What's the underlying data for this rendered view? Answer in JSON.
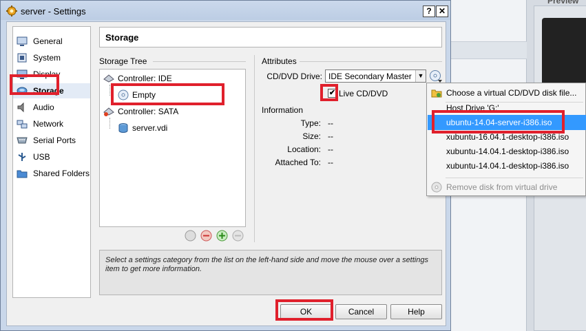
{
  "window": {
    "title": "server - Settings",
    "help_glyph": "?",
    "close_glyph": "✕"
  },
  "categories": [
    {
      "label": "General",
      "icon": "monitor-icon"
    },
    {
      "label": "System",
      "icon": "chip-icon"
    },
    {
      "label": "Display",
      "icon": "display-icon"
    },
    {
      "label": "Storage",
      "icon": "storage-disk-icon",
      "selected": true
    },
    {
      "label": "Audio",
      "icon": "speaker-icon"
    },
    {
      "label": "Network",
      "icon": "network-icon"
    },
    {
      "label": "Serial Ports",
      "icon": "serial-port-icon"
    },
    {
      "label": "USB",
      "icon": "usb-icon"
    },
    {
      "label": "Shared Folders",
      "icon": "folder-icon"
    }
  ],
  "page_title": "Storage",
  "storage_tree": {
    "title": "Storage Tree",
    "ide_controller": "Controller: IDE",
    "ide_disk": "Empty",
    "sata_controller": "Controller: SATA",
    "sata_disk": "server.vdi"
  },
  "attributes": {
    "title": "Attributes",
    "drive_label": "CD/DVD Drive:",
    "drive_value": "IDE Secondary Master",
    "live_cd_label": "Live CD/DVD",
    "live_cd_checked": true
  },
  "information": {
    "title": "Information",
    "type_label": "Type:",
    "type_value": "--",
    "size_label": "Size:",
    "size_value": "--",
    "location_label": "Location:",
    "location_value": "--",
    "attached_label": "Attached To:",
    "attached_value": "--"
  },
  "description": "Select a settings category from the list on the left-hand side and move the mouse over a settings item to get more information.",
  "buttons": {
    "ok": "OK",
    "cancel": "Cancel",
    "help": "Help"
  },
  "disk_menu": {
    "items": [
      {
        "label": "Choose a virtual CD/DVD disk file...",
        "icon": "folder-choose-icon"
      },
      {
        "label": "Host Drive 'G:'"
      },
      {
        "label": "ubuntu-14.04-server-i386.iso",
        "active": true
      },
      {
        "label": "xubuntu-16.04.1-desktop-i386.iso"
      },
      {
        "label": "xubuntu-14.04.1-desktop-i386.iso"
      },
      {
        "label": "xubuntu-14.04.1-desktop-i386.iso"
      },
      {
        "label": "Remove disk from virtual drive",
        "icon": "remove-disk-icon",
        "disabled": true
      }
    ]
  },
  "background_app": {
    "preview_label": "Preview"
  },
  "colors": {
    "highlight": "#e0202c",
    "menu_active": "#3399ff",
    "title_bar": "#c9d7ea"
  }
}
